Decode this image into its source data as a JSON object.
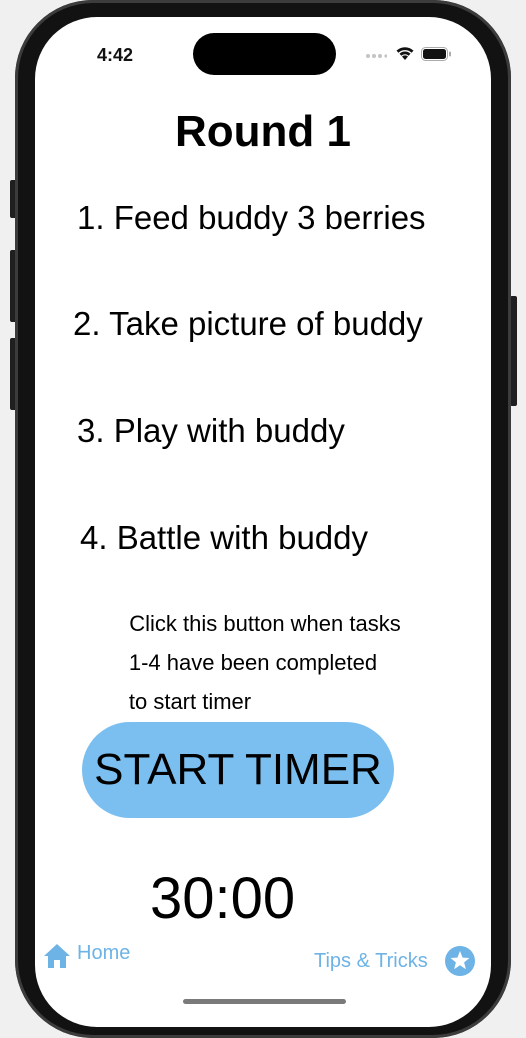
{
  "status_bar": {
    "time": "4:42"
  },
  "title": "Round 1",
  "tasks": [
    "1. Feed buddy 3 berries",
    "2. Take picture of buddy",
    "3. Play with buddy",
    "4. Battle with buddy"
  ],
  "instructions": [
    "Click this button when tasks",
    "1-4 have been completed",
    "to start timer"
  ],
  "start_button_label": "START TIMER",
  "timer": "30:00",
  "tab_bar": {
    "home_label": "Home",
    "home_icon": "house-icon",
    "tips_label": "Tips & Tricks",
    "tips_icon": "star-circle-icon"
  },
  "colors": {
    "button_fill": "#7bbff0",
    "tab_tint": "#6db3e6"
  }
}
